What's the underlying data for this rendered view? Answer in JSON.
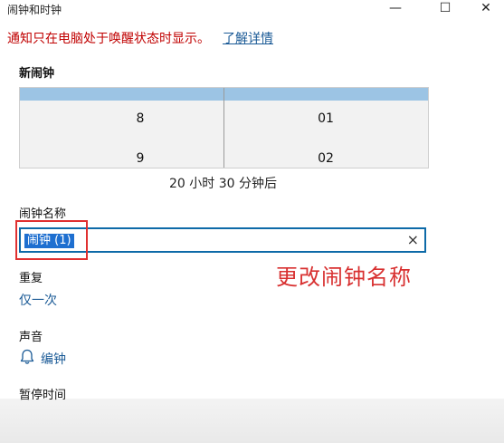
{
  "window": {
    "title": "闹钟和时钟",
    "minimize": "—",
    "maximize": "☐",
    "close": "✕"
  },
  "notice": {
    "text": "通知只在电脑处于唤醒状态时显示。",
    "link": "了解详情"
  },
  "new_alarm": {
    "title": "新闹钟",
    "hours": [
      "8",
      "9"
    ],
    "minutes": [
      "01",
      "02"
    ],
    "countdown": "20 小时 30 分钟后"
  },
  "alarm_name": {
    "label": "闹钟名称",
    "value": "闹钟 (1)",
    "clear": "×"
  },
  "annotation": "更改闹钟名称",
  "repeat": {
    "label": "重复",
    "value": "仅一次"
  },
  "sound": {
    "label": "声音",
    "value": "编钟"
  },
  "snooze": {
    "label": "暂停时间"
  },
  "colors": {
    "accent": "#0d6aa8",
    "notice": "#c00000",
    "annotation": "#d83030",
    "selection": "#1e6fd0"
  }
}
